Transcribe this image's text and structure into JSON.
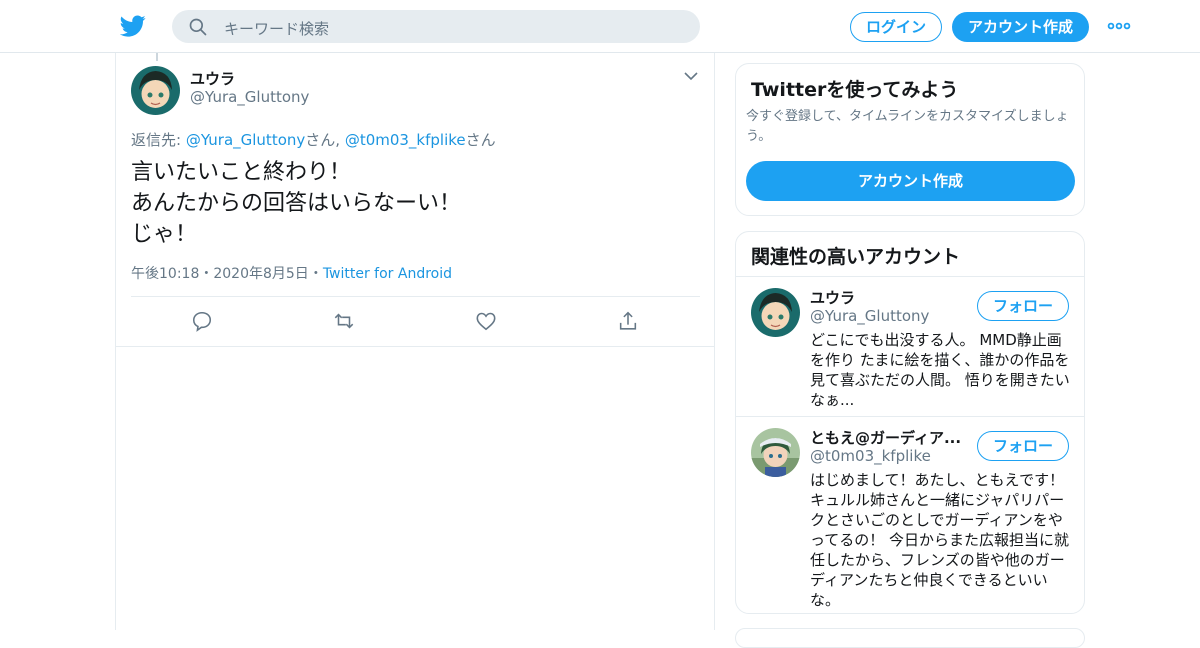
{
  "header": {
    "search_placeholder": "キーワード検索",
    "login_label": "ログイン",
    "signup_label": "アカウント作成",
    "brand_color": "#1da1f2"
  },
  "tweet": {
    "author_name": "ユウラ",
    "author_handle": "@Yura_Gluttony",
    "reply_prefix": "返信先: ",
    "reply_user1": "@Yura_Gluttony",
    "reply_suffix1": "さん, ",
    "reply_user2": "@t0m03_kfplike",
    "reply_suffix2": "さん",
    "text_lines": [
      "言いたいこと終わり！",
      "あんたからの回答はいらなーい！",
      "じゃ！"
    ],
    "time": "午後10:18",
    "date": "2020年8月5日",
    "separator": "・",
    "source": "Twitter for Android",
    "actions": [
      "reply-icon",
      "retweet-icon",
      "like-icon",
      "share-icon"
    ]
  },
  "signup_card": {
    "title": "Twitterを使ってみよう",
    "subtitle": "今すぐ登録して、タイムラインをカスタマイズしましょう。",
    "button_label": "アカウント作成"
  },
  "related_card": {
    "title": "関連性の高いアカウント",
    "accounts": [
      {
        "name": "ユウラ",
        "handle": "@Yura_Gluttony",
        "follow_label": "フォロー",
        "bio": "どこにでも出没する人。 MMD静止画を作り たまに絵を描く、誰かの作品を見て喜ぶただの人間。 悟りを開きたいなぁ..."
      },
      {
        "name": "ともえ@ガーディア...",
        "handle": "@t0m03_kfplike",
        "follow_label": "フォロー",
        "bio": "はじめまして！あたし、ともえです！キュルル姉さんと一緒にジャパリパークとさいごのとしでガーディアンをやってるの！ 今日からまた広報担当に就任したから、フレンズの皆や他のガーディアンたちと仲良くできるといいな。"
      }
    ]
  }
}
